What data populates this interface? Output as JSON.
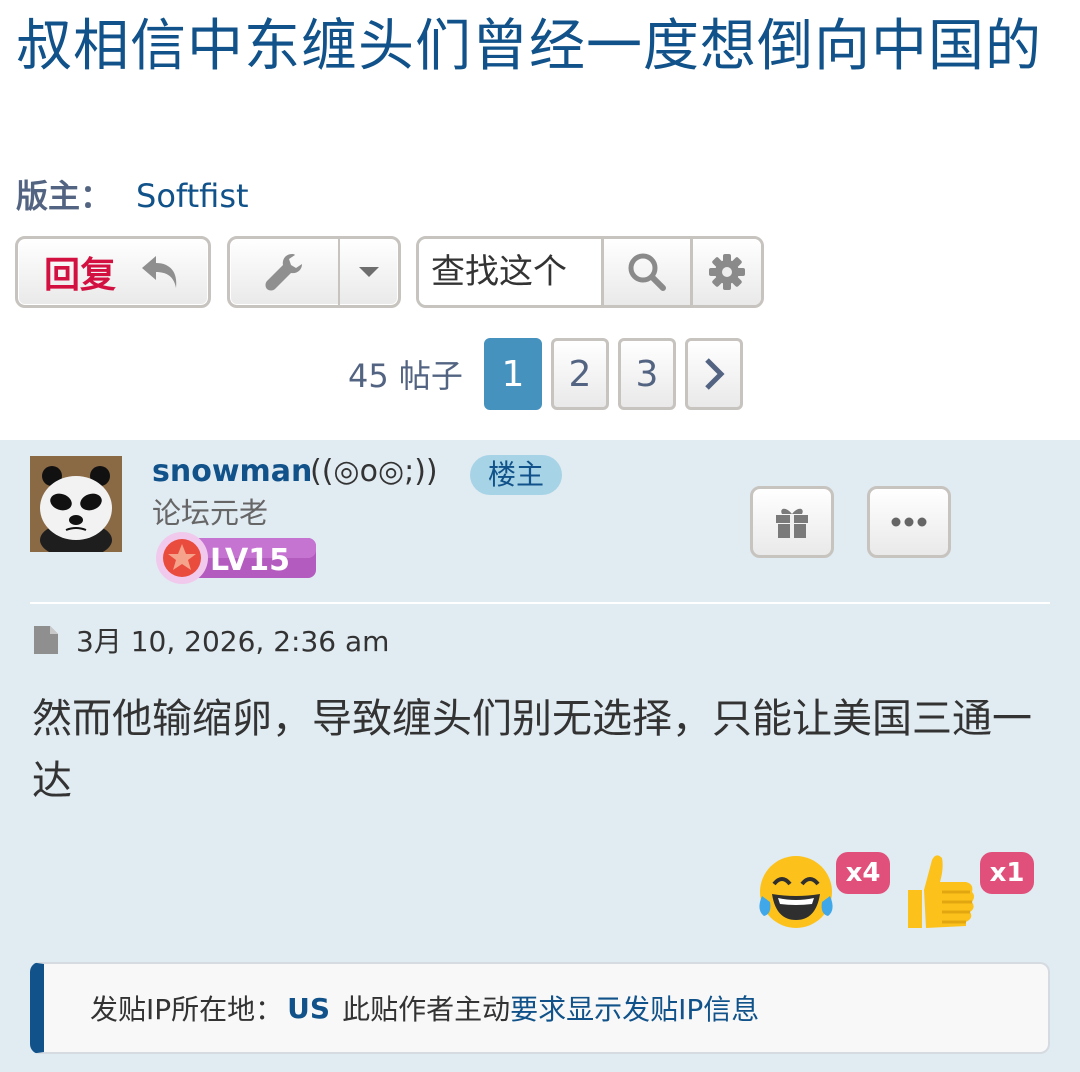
{
  "topic": {
    "title": "叔相信中东缠头们曾经一度想倒向中国的",
    "moderator_label": "版主：",
    "moderator_name": "Softfist"
  },
  "toolbar": {
    "reply_label": "回复",
    "search_placeholder": "查找这个",
    "icons": [
      "reply-arrow-icon",
      "wrench-icon",
      "caret-down-icon",
      "search-icon",
      "gear-icon"
    ]
  },
  "pagination": {
    "post_count": "45 帖子",
    "pages": [
      "1",
      "2",
      "3"
    ],
    "current": "1"
  },
  "post": {
    "username": "snowman",
    "user_tag": "((◎o◎;))",
    "op_badge": "楼主",
    "rank": "论坛元老",
    "level": "LV15",
    "date": "3月 10, 2026, 2:36 am",
    "content": "然而他输缩卵，导致缠头们别无选择，只能让美国三通一达",
    "reactions": [
      {
        "icon": "laughing-tears-icon",
        "count": "x4"
      },
      {
        "icon": "thumbs-up-icon",
        "count": "x1"
      }
    ],
    "ip_info": {
      "label": "发贴IP所在地：",
      "country": "US",
      "text": "此贴作者主动",
      "link": "要求显示发贴IP信息"
    }
  },
  "colors": {
    "title": "#105289",
    "reply": "#d31141",
    "page_current": "#4692bf",
    "post_bg": "#e1ebf2",
    "badge": "#a7d3e6",
    "reaction_count": "#e0507a"
  }
}
